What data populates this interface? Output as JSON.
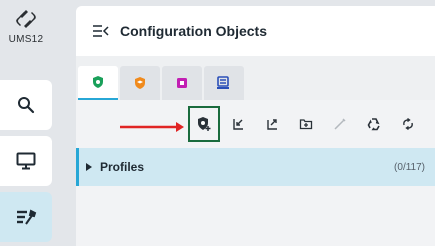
{
  "app": {
    "logo_text": "UMS12"
  },
  "rail": {
    "items": [
      {
        "icon": "search-icon"
      },
      {
        "icon": "monitor-icon"
      },
      {
        "icon": "tools-icon",
        "active": true
      }
    ]
  },
  "panel": {
    "title": "Configuration Objects"
  },
  "tabs": [
    {
      "icon": "shield-profile-icon",
      "color": "#1aa05a",
      "active": true
    },
    {
      "icon": "hat-icon",
      "color": "#f08a1c"
    },
    {
      "icon": "device-icon",
      "color": "#c21fb3"
    },
    {
      "icon": "firmware-icon",
      "color": "#2a4fb8"
    }
  ],
  "toolbar": {
    "tools": [
      "new-profile-icon",
      "import-icon",
      "export-icon",
      "new-folder-icon",
      "edit-icon",
      "recycle-icon",
      "refresh-icon"
    ],
    "annotation_arrow_color": "#e02424",
    "highlight_color": "#1a6b3d"
  },
  "tree": {
    "rows": [
      {
        "label": "Profiles",
        "count": "(0/117)"
      }
    ]
  }
}
